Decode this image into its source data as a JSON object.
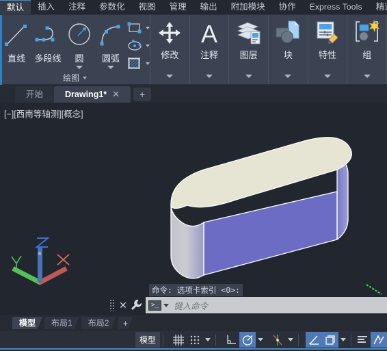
{
  "app": {
    "accent_color": "#3f8fd0",
    "ribbon_bg": "#3b4252",
    "viewport_bg": "#22262e"
  },
  "ribbon_tabs": [
    {
      "label": "默认",
      "active": true
    },
    {
      "label": "插入",
      "active": false
    },
    {
      "label": "注释",
      "active": false
    },
    {
      "label": "参数化",
      "active": false
    },
    {
      "label": "视图",
      "active": false
    },
    {
      "label": "管理",
      "active": false
    },
    {
      "label": "输出",
      "active": false
    },
    {
      "label": "附加模块",
      "active": false
    },
    {
      "label": "协作",
      "active": false
    },
    {
      "label": "Express Tools",
      "active": false
    },
    {
      "label": "精选",
      "active": false
    }
  ],
  "draw_panel": {
    "title": "绘图",
    "tools": [
      {
        "label": "直线",
        "icon": "line-icon",
        "has_dropdown": false
      },
      {
        "label": "多段线",
        "icon": "polyline-icon",
        "has_dropdown": false
      },
      {
        "label": "圆",
        "icon": "circle-icon",
        "has_dropdown": true
      },
      {
        "label": "圆弧",
        "icon": "arc-icon",
        "has_dropdown": true
      }
    ],
    "mini_tools": [
      {
        "icon": "rectangle-icon"
      },
      {
        "icon": "ellipse-arc-icon"
      },
      {
        "icon": "hatch-icon"
      }
    ]
  },
  "panels": [
    {
      "label": "修改",
      "icon": "move-icon",
      "title": ""
    },
    {
      "label": "注释",
      "icon": "text-a-icon",
      "title": ""
    },
    {
      "label": "图层",
      "icon": "layers-icon",
      "title": ""
    },
    {
      "label": "块",
      "icon": "block-icon",
      "title": ""
    },
    {
      "label": "特性",
      "icon": "properties-icon",
      "title": ""
    },
    {
      "label": "组",
      "icon": "group-icon",
      "title": ""
    }
  ],
  "file_tabs": {
    "tabs": [
      {
        "label": "开始",
        "active": false,
        "closable": false
      },
      {
        "label": "Drawing1*",
        "active": true,
        "closable": true,
        "close_glyph": "✕"
      }
    ],
    "new_tab_glyph": "+"
  },
  "viewport": {
    "label": "[−][西南等轴测][概念]",
    "model": {
      "type": "3d-extruded-slot",
      "top_face_color": "#e6e4d3",
      "side_face_color": "#6c6cc4",
      "curved_face_light": "#c9c9ce",
      "edge_color": "#ffffff"
    },
    "ucs_icon": {
      "x_label": "X",
      "y_label": "Y",
      "z_label": "Z",
      "x_color": "#c0504d",
      "y_color": "#4caf50",
      "z_color": "#4a6fb5"
    }
  },
  "command_line": {
    "history": "命令:  选项卡索引 <0>:",
    "placeholder": "键入命令",
    "close_glyph": "✕",
    "prompt_glyph": ">_"
  },
  "layout_tabs": {
    "tabs": [
      {
        "label": "模型",
        "active": true
      },
      {
        "label": "布局1",
        "active": false
      },
      {
        "label": "布局2",
        "active": false
      }
    ],
    "add_glyph": "+"
  },
  "status_bar": {
    "model_button": "模型",
    "items": [
      {
        "name": "grid-display-toggle",
        "icon": "grid-icon",
        "on": false,
        "dropdown": false
      },
      {
        "name": "snap-mode-toggle",
        "icon": "snap-dots-icon",
        "on": false,
        "dropdown": true
      },
      {
        "name": "ortho-mode-toggle",
        "icon": "ortho-icon",
        "on": false,
        "dropdown": false
      },
      {
        "name": "polar-tracking-toggle",
        "icon": "polar-icon",
        "on": true,
        "dropdown": true
      },
      {
        "name": "object-snap-toggle",
        "icon": "osnap-icon",
        "on": false,
        "dropdown": true
      },
      {
        "name": "object-snap-tracking-toggle",
        "icon": "otrack-icon",
        "on": true,
        "dropdown": false
      },
      {
        "name": "ucs-icon-toggle",
        "icon": "ucs-box-icon",
        "on": true,
        "dropdown": true
      },
      {
        "name": "annotation-scale-icon",
        "icon": "annotation-lines-icon",
        "on": false,
        "dropdown": false
      },
      {
        "name": "workspace-switch-icon",
        "icon": "workspace-icon",
        "on": true,
        "dropdown": false
      }
    ]
  }
}
